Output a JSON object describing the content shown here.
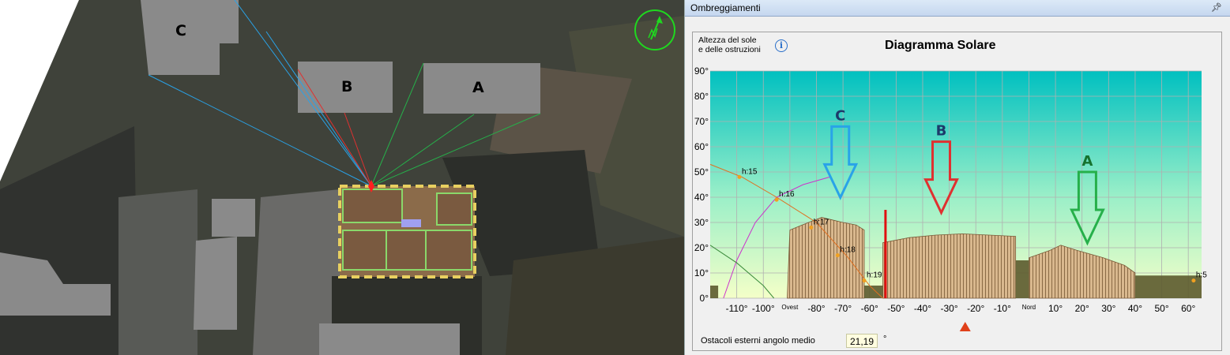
{
  "map": {
    "buildings": [
      {
        "label": "C",
        "color": "#29a3e8"
      },
      {
        "label": "B",
        "color": "#e03030"
      },
      {
        "label": "A",
        "color": "#26b04a"
      }
    ],
    "compass_icon": "north-arrow-icon"
  },
  "panel": {
    "header": "Ombreggiamenti",
    "pin_icon": "pin-icon",
    "axis_title_line1": "Altezza del sole",
    "axis_title_line2": "e delle ostruzioni",
    "info_icon": "i",
    "chart_title": "Diagramma Solare",
    "footer_label": "Ostacoli esterni angolo medio",
    "footer_value": "21,19",
    "footer_unit": "°"
  },
  "chart_data": {
    "type": "area",
    "title": "Diagramma Solare",
    "ylabel": "Altezza del sole e delle ostruzioni",
    "xlim": [
      -120,
      65
    ],
    "ylim": [
      0,
      90
    ],
    "x_ticks": [
      {
        "x": -110,
        "label": "-110°"
      },
      {
        "x": -100,
        "label": "-100°"
      },
      {
        "x": -90,
        "label": "Ovest"
      },
      {
        "x": -80,
        "label": "-80°"
      },
      {
        "x": -70,
        "label": "-70°"
      },
      {
        "x": -60,
        "label": "-60°"
      },
      {
        "x": -50,
        "label": "-50°"
      },
      {
        "x": -40,
        "label": "-40°"
      },
      {
        "x": -30,
        "label": "-30°"
      },
      {
        "x": -20,
        "label": "-20°"
      },
      {
        "x": -10,
        "label": "-10°"
      },
      {
        "x": 0,
        "label": "Nord"
      },
      {
        "x": 10,
        "label": "10°"
      },
      {
        "x": 20,
        "label": "20°"
      },
      {
        "x": 30,
        "label": "30°"
      },
      {
        "x": 40,
        "label": "40°"
      },
      {
        "x": 50,
        "label": "50°"
      },
      {
        "x": 60,
        "label": "60°"
      }
    ],
    "y_ticks": [
      {
        "y": 0,
        "label": "0°"
      },
      {
        "y": 10,
        "label": "10°"
      },
      {
        "y": 20,
        "label": "20°"
      },
      {
        "y": 30,
        "label": "30°"
      },
      {
        "y": 40,
        "label": "40°"
      },
      {
        "y": 50,
        "label": "50°"
      },
      {
        "y": 60,
        "label": "60°"
      },
      {
        "y": 70,
        "label": "70°"
      },
      {
        "y": 80,
        "label": "80°"
      },
      {
        "y": 90,
        "label": "90°"
      }
    ],
    "obstructions": [
      {
        "name": "C",
        "points": [
          [
            -91,
            0
          ],
          [
            -90,
            27
          ],
          [
            -83,
            30
          ],
          [
            -78,
            32
          ],
          [
            -74,
            31
          ],
          [
            -70,
            30
          ],
          [
            -65,
            29
          ],
          [
            -62,
            27
          ],
          [
            -62,
            0
          ]
        ]
      },
      {
        "name": "B",
        "points": [
          [
            -55,
            0
          ],
          [
            -55,
            22
          ],
          [
            -45,
            24
          ],
          [
            -35,
            25
          ],
          [
            -25,
            25.5
          ],
          [
            -15,
            25
          ],
          [
            -5,
            24.5
          ],
          [
            -5,
            0
          ]
        ]
      },
      {
        "name": "A",
        "points": [
          [
            0,
            0
          ],
          [
            0,
            16
          ],
          [
            8,
            19
          ],
          [
            12,
            21
          ],
          [
            18,
            19
          ],
          [
            28,
            16
          ],
          [
            36,
            13
          ],
          [
            40,
            10
          ],
          [
            40,
            0
          ]
        ]
      },
      {
        "name": "ground-1",
        "points": [
          [
            -62,
            0
          ],
          [
            -62,
            5
          ],
          [
            -55,
            5
          ],
          [
            -55,
            0
          ]
        ]
      },
      {
        "name": "ground-2",
        "points": [
          [
            -5,
            0
          ],
          [
            -5,
            15
          ],
          [
            0,
            15
          ],
          [
            0,
            0
          ]
        ]
      },
      {
        "name": "ground-3",
        "points": [
          [
            40,
            0
          ],
          [
            40,
            9
          ],
          [
            65,
            9
          ],
          [
            65,
            0
          ]
        ]
      },
      {
        "name": "ground-4",
        "points": [
          [
            -120,
            0
          ],
          [
            -120,
            5
          ],
          [
            -117,
            5
          ],
          [
            -117,
            0
          ]
        ]
      }
    ],
    "sun_paths": [
      {
        "color": "#cc33cc",
        "points": [
          [
            -115,
            0
          ],
          [
            -110,
            15
          ],
          [
            -103,
            30
          ],
          [
            -95,
            40
          ],
          [
            -85,
            45
          ],
          [
            -75,
            48
          ]
        ]
      },
      {
        "color": "#3c8c3c",
        "points": [
          [
            -120,
            21
          ],
          [
            -110,
            14
          ],
          [
            -100,
            5
          ],
          [
            -96,
            0
          ]
        ]
      },
      {
        "color": "#e07020",
        "points": [
          [
            -120,
            53
          ],
          [
            -108,
            48
          ],
          [
            -95,
            40
          ],
          [
            -80,
            30
          ],
          [
            -68,
            16
          ],
          [
            -60,
            5
          ],
          [
            -55,
            0
          ]
        ]
      }
    ],
    "hour_markers": [
      {
        "label": "h:15",
        "x": -109,
        "y": 48
      },
      {
        "label": "h:16",
        "x": -95,
        "y": 39
      },
      {
        "label": "h:17",
        "x": -82,
        "y": 28
      },
      {
        "label": "h:18",
        "x": -72,
        "y": 17
      },
      {
        "label": "h:19",
        "x": -62,
        "y": 7
      },
      {
        "label": "h:5",
        "x": 62,
        "y": 7
      }
    ],
    "obstruction_labels": [
      {
        "label": "C",
        "x": -71,
        "y": 68,
        "color": "#29a3e8"
      },
      {
        "label": "B",
        "x": -33,
        "y": 62,
        "color": "#e03030"
      },
      {
        "label": "A",
        "x": 22,
        "y": 50,
        "color": "#26b04a"
      }
    ],
    "red_line_x": -54,
    "marker_x": -24,
    "grid": true
  }
}
